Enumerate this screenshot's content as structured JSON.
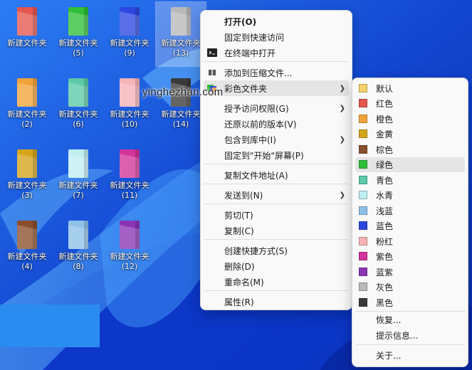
{
  "watermark": "yinghezhan.com",
  "desktop": {
    "icons": [
      {
        "label": "新建文件夹",
        "color": "#e4564f"
      },
      {
        "label": "新建文件夹\n(5)",
        "color": "#2fbf37"
      },
      {
        "label": "新建文件夹\n(9)",
        "color": "#2b47e0"
      },
      {
        "label": "新建文件夹\n(13)",
        "color": "#b9b9b9",
        "selected": true
      },
      {
        "label": "新建文件夹\n(2)",
        "color": "#f2a23a"
      },
      {
        "label": "新建文件夹\n(6)",
        "color": "#5cc9a7"
      },
      {
        "label": "新建文件夹\n(10)",
        "color": "#f5b3b6"
      },
      {
        "label": "新建文件夹\n(14)",
        "color": "#3a3a3a"
      },
      {
        "label": "新建文件夹\n(3)",
        "color": "#d4a51b"
      },
      {
        "label": "新建文件夹\n(7)",
        "color": "#bfeef2"
      },
      {
        "label": "新建文件夹\n(11)",
        "color": "#d3349a"
      },
      {
        "label": "新建文件夹\n(4)",
        "color": "#8b4f2c"
      },
      {
        "label": "新建文件夹\n(8)",
        "color": "#8ec1e8"
      },
      {
        "label": "新建文件夹\n(12)",
        "color": "#8a34b5"
      }
    ]
  },
  "context_menu": {
    "items": [
      {
        "label": "打开(O)",
        "bold": true
      },
      {
        "label": "固定到快速访问"
      },
      {
        "label": "在终端中打开",
        "icon": "terminal-icon"
      },
      {
        "label": "添加到压缩文件...",
        "icon": "archive-icon"
      },
      {
        "label": "彩色文件夹",
        "icon": "color-folder-icon",
        "submenu": true,
        "hover": true
      },
      {
        "label": "授予访问权限(G)",
        "submenu": true
      },
      {
        "label": "还原以前的版本(V)"
      },
      {
        "label": "包含到库中(I)",
        "submenu": true
      },
      {
        "label": "固定到\"开始\"屏幕(P)"
      },
      {
        "label": "复制文件地址(A)"
      },
      {
        "label": "发送到(N)",
        "submenu": true
      },
      {
        "label": "剪切(T)"
      },
      {
        "label": "复制(C)"
      },
      {
        "label": "创建快捷方式(S)"
      },
      {
        "label": "删除(D)"
      },
      {
        "label": "重命名(M)"
      },
      {
        "label": "属性(R)"
      }
    ]
  },
  "color_submenu": {
    "items": [
      {
        "label": "默认",
        "color": "#f5d36b"
      },
      {
        "label": "红色",
        "color": "#e4564f"
      },
      {
        "label": "橙色",
        "color": "#f2a23a"
      },
      {
        "label": "金黄",
        "color": "#d4a51b"
      },
      {
        "label": "棕色",
        "color": "#8b4f2c"
      },
      {
        "label": "绿色",
        "color": "#2fbf37",
        "hover": true
      },
      {
        "label": "青色",
        "color": "#5cc9a7"
      },
      {
        "label": "水青",
        "color": "#bfeef2"
      },
      {
        "label": "浅蓝",
        "color": "#8ec1e8"
      },
      {
        "label": "蓝色",
        "color": "#2b47e0"
      },
      {
        "label": "粉红",
        "color": "#f5b3b6"
      },
      {
        "label": "紫色",
        "color": "#d3349a"
      },
      {
        "label": "蓝紫",
        "color": "#8a34b5"
      },
      {
        "label": "灰色",
        "color": "#b9b9b9"
      },
      {
        "label": "黑色",
        "color": "#3a3a3a"
      },
      {
        "label": "恢复..."
      },
      {
        "label": "提示信息..."
      },
      {
        "label": "关于..."
      }
    ]
  }
}
